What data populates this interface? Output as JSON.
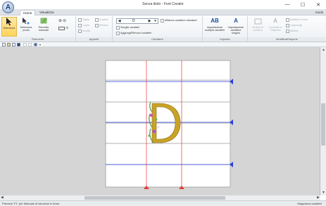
{
  "window": {
    "title": "Senza titolo - Font Creator",
    "logo": "A"
  },
  "window_controls": {
    "minimize": "—",
    "maximize": "☐",
    "close": "✕"
  },
  "tabs": [
    {
      "label": "Home"
    },
    {
      "label": "Visualizza"
    }
  ],
  "help": "Guida",
  "ribbon": {
    "strumenti": {
      "label": "Strumenti",
      "seleziona": "Seleziona",
      "seleziona_punto": "Seleziona punto",
      "pennello_manuale": "Pennello manuale"
    },
    "appunti": {
      "label": "Appunti",
      "taglia": "Taglia",
      "copia": "Copia",
      "incolla": "Incolla",
      "duplica": "Duplica",
      "elimina": "Elimina"
    },
    "carattere": {
      "label": "Carattere",
      "current_char": "D",
      "prev": "◀",
      "next": "▶",
      "menu": "▾",
      "affianca": "Affianca carattere standard",
      "sceglie": "Sceglie caratteri",
      "aggiungi": "Aggiungi/Rimuovi caratteri"
    },
    "imposta": {
      "label": "Imposta",
      "multipli": "Impostazione multipla caratteri",
      "singolo": "Impostazione carattere singolo"
    },
    "modifica": {
      "label": "Modifica/Dispone",
      "ordine": "Ordine di cucitura",
      "convertti": "Converti in Trapunto",
      "modifica_punto": "Modifica Punto",
      "capovolgi": "Capovolgi",
      "allinea": "Allinea"
    }
  },
  "statusbar": {
    "left": "Premere 'F1' per Manuale di istruzioni in linea.",
    "right": "Mappatura caratteri"
  },
  "colors": {
    "guide_blue": "#2d3fe0",
    "guide_red": "#e23b3b",
    "letter_gold": "#c9a227"
  }
}
